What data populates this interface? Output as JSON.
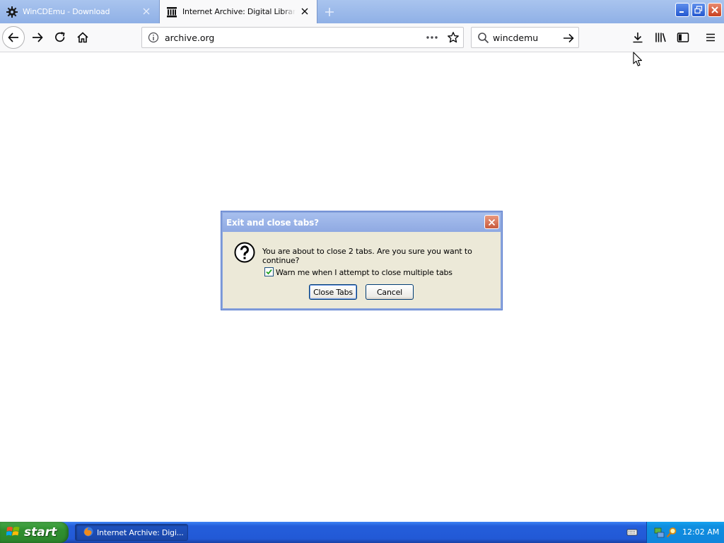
{
  "tabs": [
    {
      "title": "WinCDEmu - Download",
      "favicon": "gear-icon",
      "active": false
    },
    {
      "title": "Internet Archive: Digital Library of",
      "favicon": "archive-icon",
      "active": true
    }
  ],
  "navbar": {
    "url": "archive.org",
    "search_value": "wincdemu"
  },
  "dialog": {
    "title": "Exit and close tabs?",
    "message": "You are about to close 2 tabs. Are you sure you want to continue?",
    "checkbox_label": "Warn me when I attempt to close multiple tabs",
    "checkbox_checked": true,
    "confirm_label": "Close Tabs",
    "cancel_label": "Cancel"
  },
  "taskbar": {
    "start_label": "start",
    "task_label": "Internet Archive: Digi...",
    "clock": "12:02 AM"
  },
  "colors": {
    "titlebar": "#8fb0e6",
    "taskbar": "#245edb",
    "start_green": "#2f8f2f",
    "tray": "#0f8fe0",
    "dialog_bg": "#ece9d8"
  }
}
